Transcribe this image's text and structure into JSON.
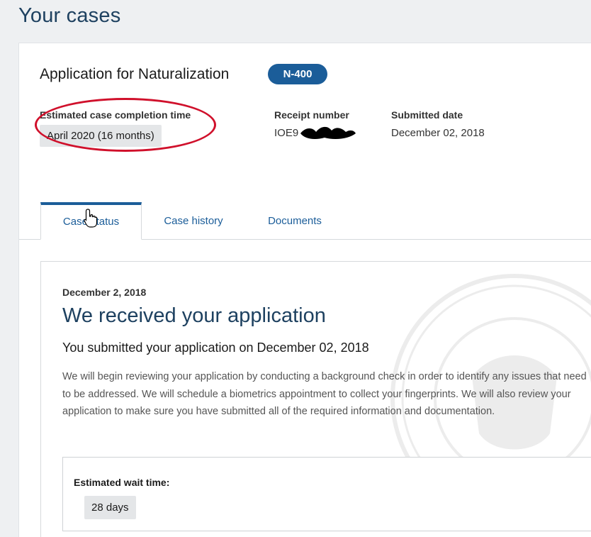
{
  "page": {
    "title": "Your cases"
  },
  "case": {
    "title": "Application for Naturalization",
    "form_badge": "N-400",
    "completion_label": "Estimated case completion time",
    "completion_value": "April 2020 (16 months)",
    "receipt_label": "Receipt number",
    "receipt_value": "IOE9",
    "submitted_label": "Submitted date",
    "submitted_value": "December 02, 2018"
  },
  "tabs": [
    {
      "label": "Case status",
      "active": true
    },
    {
      "label": "Case history",
      "active": false
    },
    {
      "label": "Documents",
      "active": false
    }
  ],
  "status": {
    "date": "December 2, 2018",
    "heading": "We received your application",
    "subheading": "You submitted your application on December 02, 2018",
    "body": "We will begin reviewing your application by conducting a background check in order to identify any issues that need to be addressed. We will schedule a biometrics appointment to collect your fingerprints. We will also review your application to make sure you have submitted all of the required information and documentation.",
    "wait_label": "Estimated wait time:",
    "wait_value": "28 days"
  },
  "colors": {
    "accent": "#1b5d99",
    "heading": "#1e4160",
    "annotation": "#d0102b"
  },
  "icons": {
    "cursor": "hand-pointer-icon",
    "seal": "dhs-seal-watermark"
  }
}
